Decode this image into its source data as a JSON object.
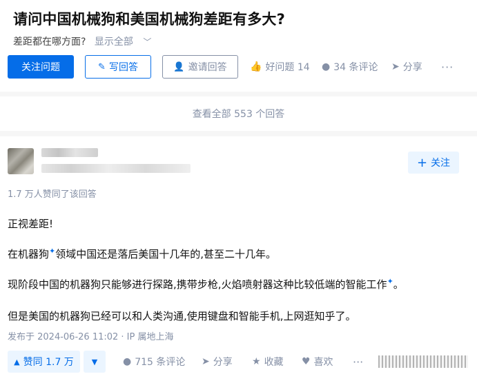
{
  "question": {
    "title": "请问中国机械狗和美国机械狗差距有多大?",
    "detail": "差距都在哪方面?",
    "show_all": "显示全部"
  },
  "buttons": {
    "follow_question": "关注问题",
    "write_answer": "写回答",
    "invite_answer": "邀请回答"
  },
  "question_actions": {
    "good_question": "好问题 14",
    "comments": "34 条评论",
    "share": "分享",
    "more": "···"
  },
  "view_all": "查看全部 553 个回答",
  "answer": {
    "follow_button": "关注",
    "upvoters": "1.7 万人赞同了该回答",
    "paragraphs": {
      "p1": "正视差距!",
      "p2_link": "机器狗",
      "p2_prefix": "在",
      "p2_rest": "领域中国还是落后美国十几年的,甚至二十几年。",
      "p3_prefix": "现阶段中国的机器狗只能够进行探路,携带步枪,火焰喷射器这种比较低端的",
      "p3_link": "智能工作",
      "p3_suffix": "。",
      "p4": "但是美国的机器狗已经可以和人类沟通,使用键盘和智能手机,上网逛知乎了。"
    },
    "published": "发布于 2024-06-26 11:02 · IP 属地上海"
  },
  "answer_actions": {
    "upvote": "赞同 1.7 万",
    "comments": "715 条评论",
    "share": "分享",
    "collect": "收藏",
    "like": "喜欢",
    "more": "···"
  },
  "icons": {
    "spark": "✦",
    "pen": "✎",
    "invite": "👤",
    "thumb": "👍",
    "comment": "●",
    "share": "➤",
    "star": "★",
    "heart": "♥",
    "up": "▲",
    "down": "▼",
    "plus": "+",
    "chevron": "﹀"
  },
  "colors": {
    "accent": "#056de8",
    "accent_light": "#ebf5ff",
    "muted": "#8590a6",
    "text": "#121212"
  }
}
